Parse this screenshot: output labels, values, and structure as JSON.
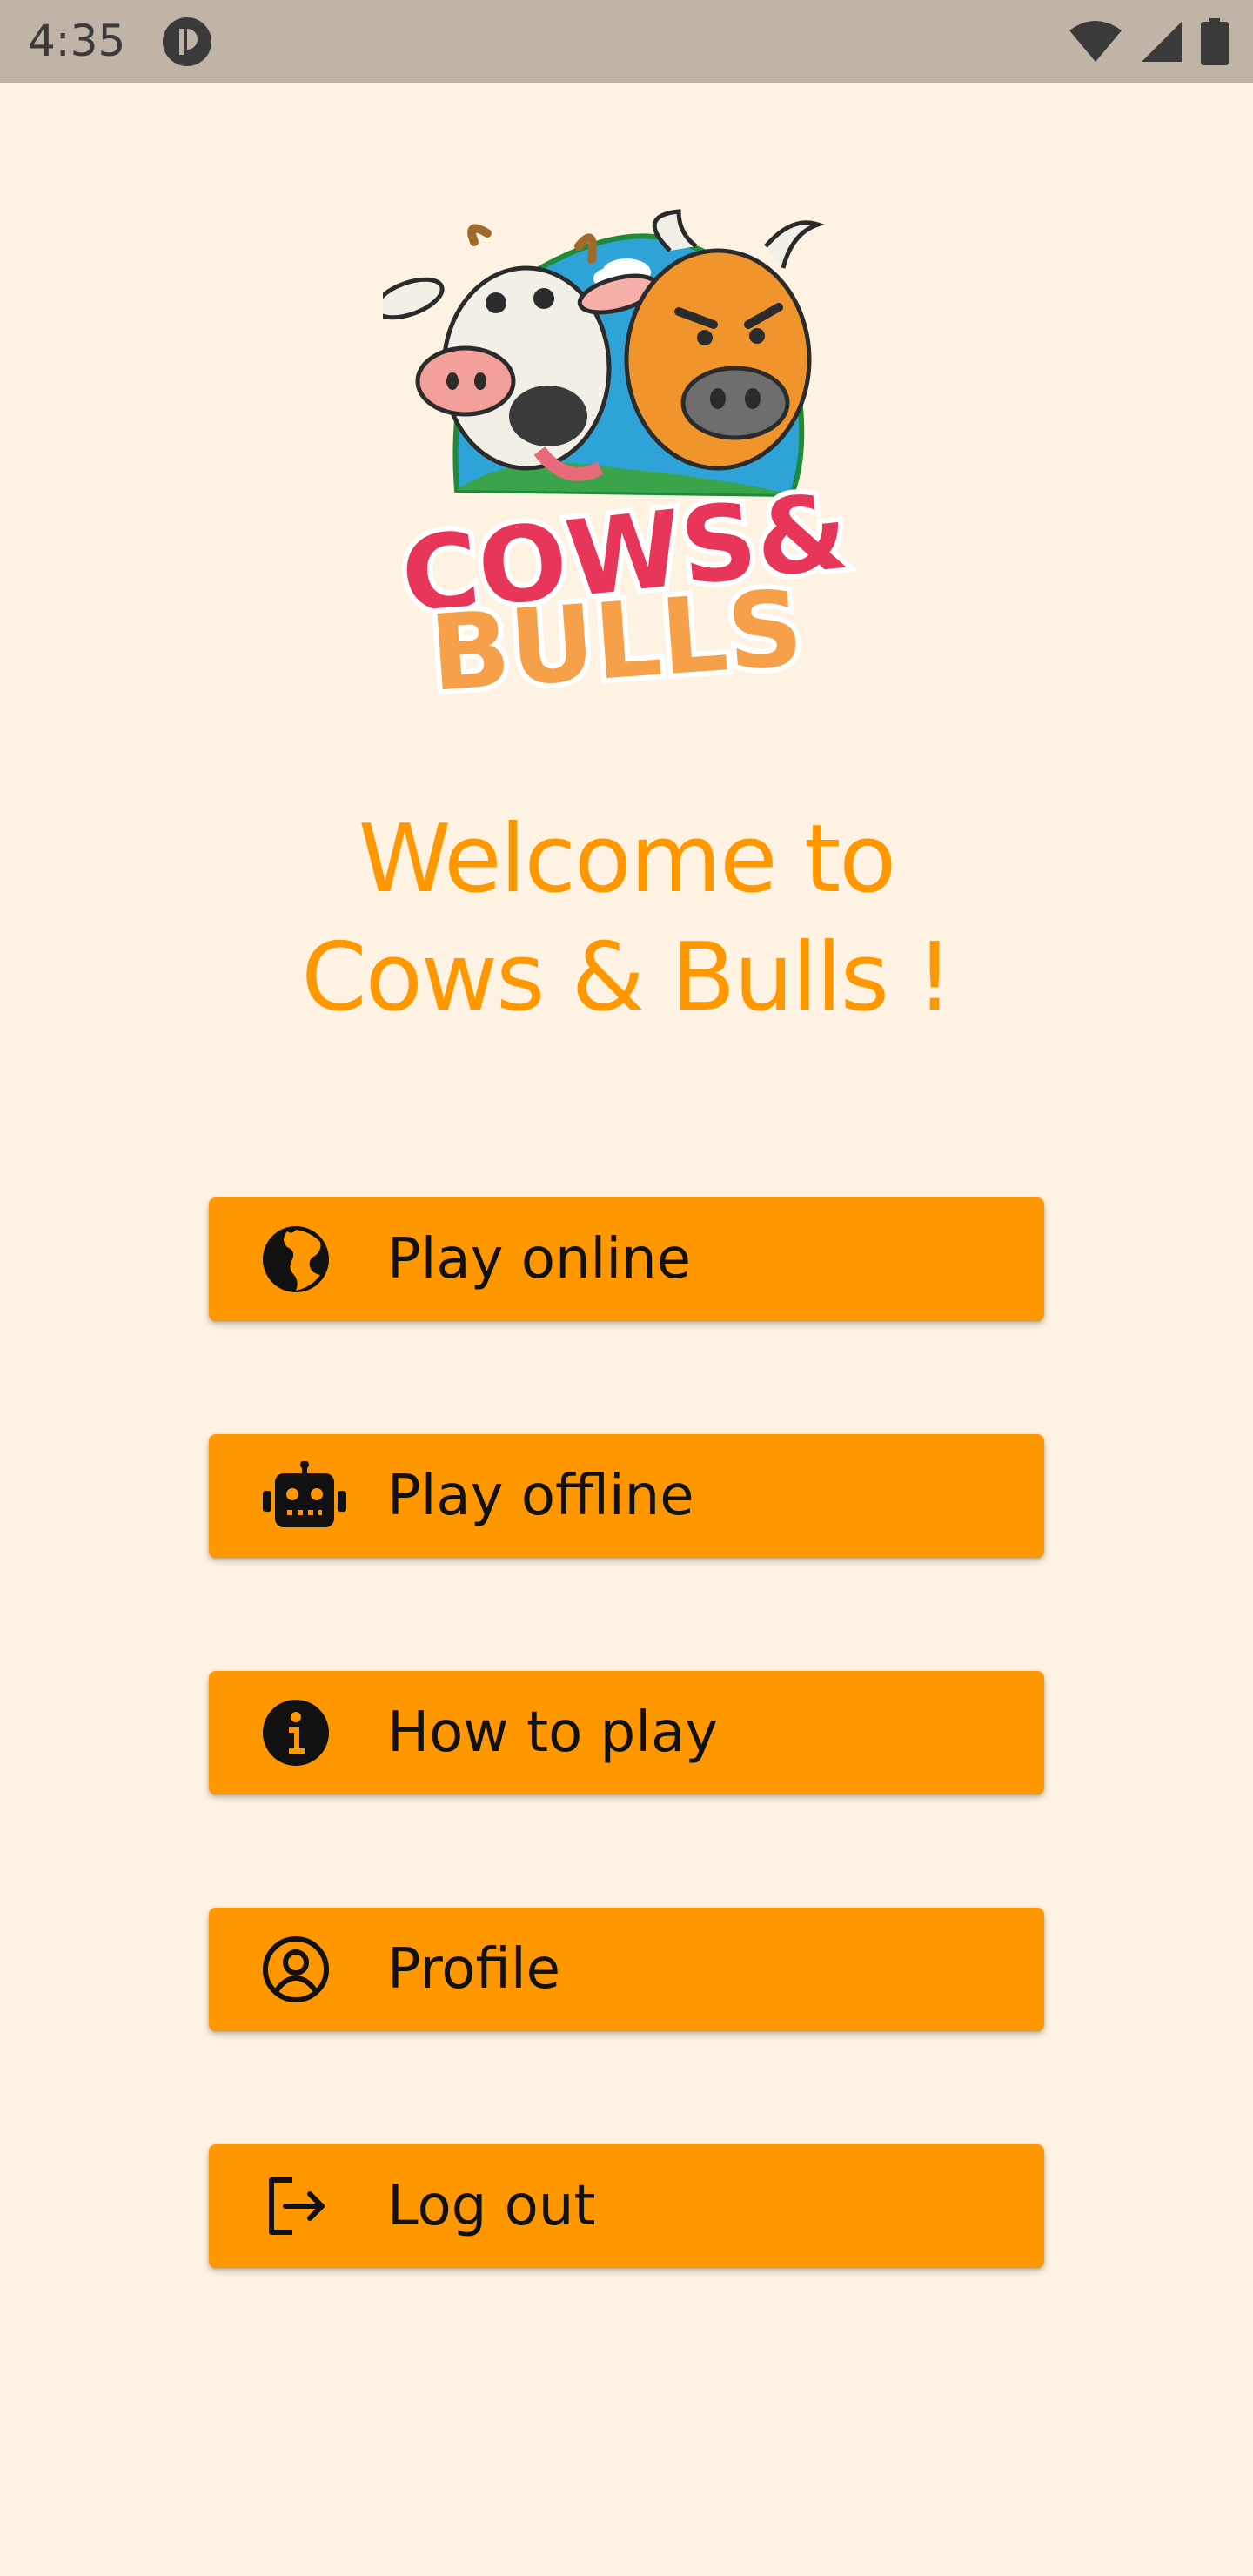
{
  "status_bar": {
    "time": "4:35",
    "icons": [
      "app-notification-icon",
      "wifi-icon",
      "cellular-signal-icon",
      "battery-icon"
    ]
  },
  "logo": {
    "line1": "COWS&",
    "line2": "BULLS"
  },
  "welcome": {
    "line1": "Welcome to",
    "line2": "Cows & Bulls !"
  },
  "menu": {
    "items": [
      {
        "label": "Play online",
        "icon": "globe-icon"
      },
      {
        "label": "Play offline",
        "icon": "robot-icon"
      },
      {
        "label": "How to play",
        "icon": "info-icon"
      },
      {
        "label": "Profile",
        "icon": "profile-icon"
      },
      {
        "label": "Log out",
        "icon": "logout-icon"
      }
    ]
  },
  "colors": {
    "background": "#fef3e2",
    "accent": "#ff9800",
    "status_bar": "#bfb4a6"
  }
}
